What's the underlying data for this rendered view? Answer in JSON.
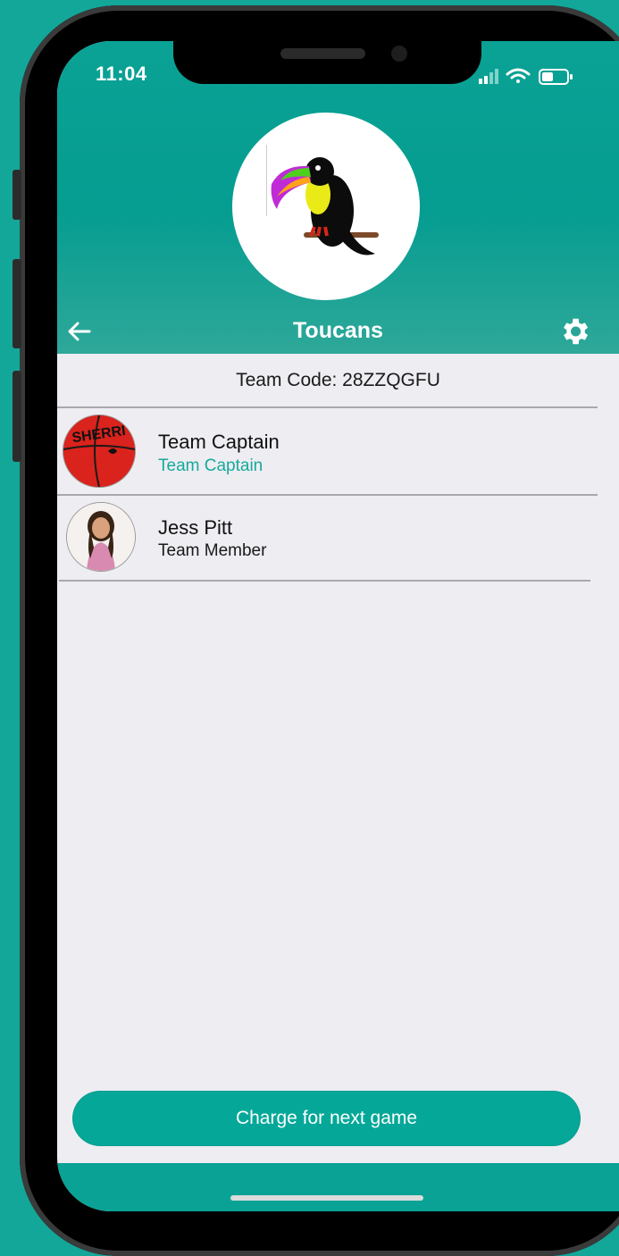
{
  "status_bar": {
    "time": "11:04"
  },
  "team": {
    "name": "Toucans",
    "code_label": "Team Code: 28ZZQGFU"
  },
  "members": [
    {
      "name": "Team Captain",
      "role": "Team Captain",
      "role_color": "#17a99b"
    },
    {
      "name": "Jess Pitt",
      "role": "Team Member",
      "role_color": "#1a1a1a"
    }
  ],
  "actions": {
    "charge_label": "Charge for next game"
  },
  "colors": {
    "accent": "#05a898",
    "header": "#0aa295",
    "background": "#ededf2"
  }
}
